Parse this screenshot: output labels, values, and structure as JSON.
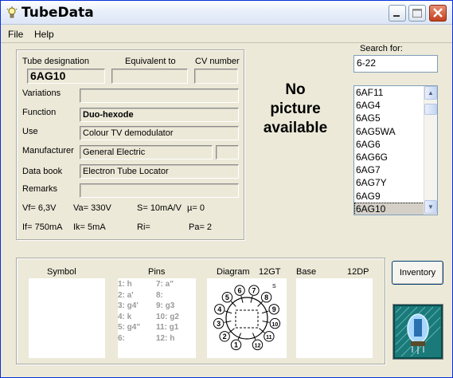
{
  "window": {
    "title": "TubeData",
    "icon": "bulb-icon"
  },
  "menu": {
    "file": "File",
    "help": "Help"
  },
  "header_labels": {
    "designation": "Tube designation",
    "equivalent": "Equivalent to",
    "cv": "CV number"
  },
  "fields": {
    "designation": "6AG10",
    "equivalent": "",
    "cv": "",
    "variations_label": "Variations",
    "variations": "",
    "function_label": "Function",
    "function": "Duo-hexode",
    "use_label": "Use",
    "use": "Colour TV demodulator",
    "manufacturer_label": "Manufacturer",
    "manufacturer": "General Electric",
    "manufacturer_extra": "",
    "databook_label": "Data book",
    "databook": "Electron Tube Locator",
    "remarks_label": "Remarks",
    "remarks": ""
  },
  "specs": {
    "vf": "Vf= 6,3V",
    "va": "Va= 330V",
    "s": "S= 10mA/V",
    "mu": "µ=   0",
    "if": "If= 750mA",
    "ik": "Ik=   5mA",
    "ri": "Ri=",
    "pa": "Pa= 2"
  },
  "picture": {
    "line1": "No",
    "line2": "picture",
    "line3": "available"
  },
  "search": {
    "label": "Search for:",
    "value": "6-22"
  },
  "tube_list": {
    "items": [
      "6AF11",
      "6AG4",
      "6AG5",
      "6AG5WA",
      "6AG6",
      "6AG6G",
      "6AG7",
      "6AG7Y",
      "6AG9",
      "6AG10"
    ],
    "selected": "6AG10"
  },
  "bottom": {
    "symbol_label": "Symbol",
    "pins_label": "Pins",
    "diagram_label": "Diagram",
    "diagram_code": "12GT",
    "base_label": "Base",
    "base_code": "12DP",
    "pins_left": [
      "1: h",
      "2: a'",
      "3: g4'",
      "4: k",
      "5: g4\"",
      "6:"
    ],
    "pins_right": [
      "7: a\"",
      "8:",
      "9: g3",
      "10: g2",
      "11: g1",
      "12: h"
    ],
    "diagram_numbers": [
      "1",
      "2",
      "3",
      "4",
      "5",
      "6",
      "7",
      "8",
      "9",
      "10",
      "11",
      "12"
    ],
    "diagram_marker": "S"
  },
  "inventory_button": "Inventory",
  "colors": {
    "title_close": "#c4401e",
    "selection": "#d4d0c8",
    "logo_bg": "#1a7a7a"
  }
}
